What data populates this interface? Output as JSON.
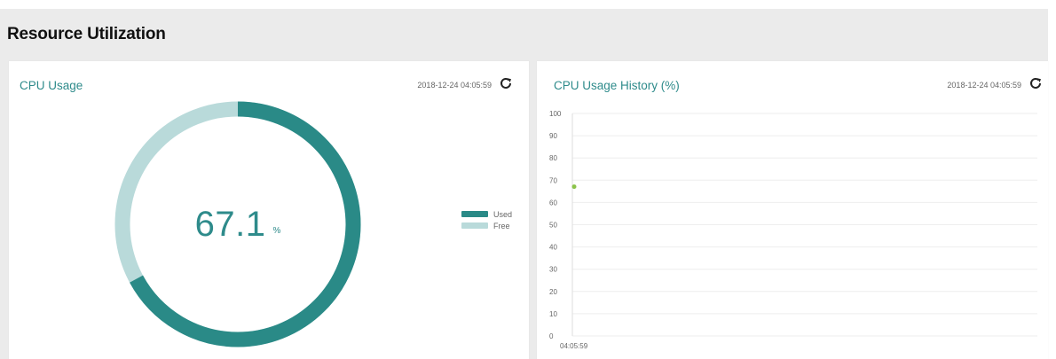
{
  "section": {
    "title": "Resource Utilization"
  },
  "cpu_usage_card": {
    "title": "CPU Usage",
    "timestamp": "2018-12-24 04:05:59",
    "value": "67.1",
    "unit": "%",
    "used_percent": 67.1,
    "legend": [
      {
        "label": "Used",
        "color": "#2a8a87"
      },
      {
        "label": "Free",
        "color": "#b9dada"
      }
    ],
    "icons": {
      "refresh": "refresh-icon"
    }
  },
  "cpu_history_card": {
    "title": "CPU Usage History (%)",
    "timestamp": "2018-12-24 04:05:59",
    "icons": {
      "refresh": "refresh-icon"
    }
  },
  "chart_data": {
    "type": "line",
    "title": "CPU Usage History (%)",
    "xlabel": "",
    "ylabel": "",
    "x": [
      "04:05:59"
    ],
    "series": [
      {
        "values": [
          67.1
        ],
        "color": "#8bc34a"
      }
    ],
    "ylim": [
      0,
      100
    ],
    "yticks": [
      "100",
      "90",
      "80",
      "70",
      "60",
      "50",
      "40",
      "30",
      "20",
      "10",
      "0"
    ],
    "xticks": [
      "04:05:59"
    ],
    "grid": true,
    "gridline_color": "#eeeeee"
  },
  "colors": {
    "accent": "#2e8b8b",
    "used": "#2a8a87",
    "free": "#b9dada",
    "background": "#ebebeb"
  }
}
